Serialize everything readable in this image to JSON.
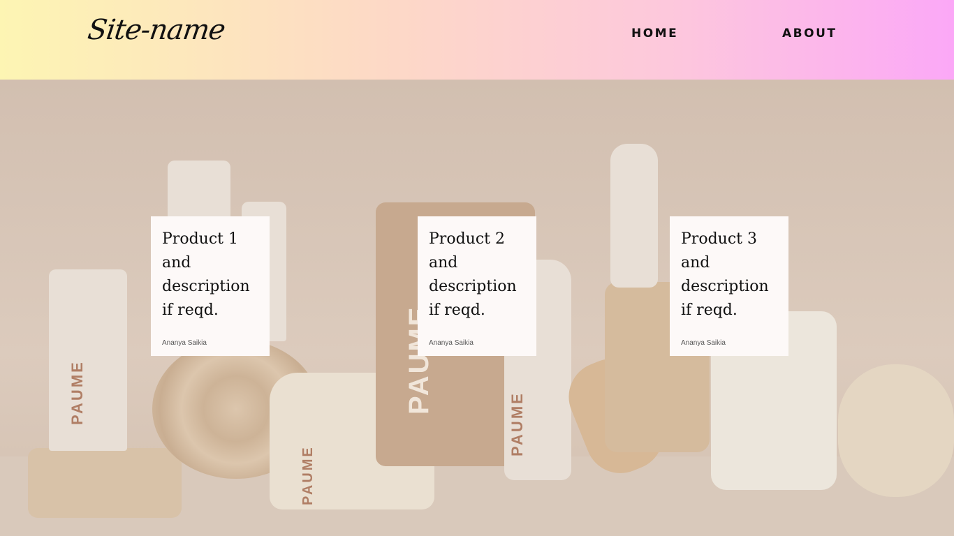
{
  "header": {
    "logo_text": "Site-name",
    "nav": {
      "home_label": "HOME",
      "about_label": "ABOUT"
    }
  },
  "hero": {
    "brand_mark": "PAUME"
  },
  "products": [
    {
      "title": "Product 1 and description if reqd.",
      "author": "Ananya Saikia"
    },
    {
      "title": "Product 2 and description if reqd.",
      "author": "Ananya Saikia"
    },
    {
      "title": "Product 3 and description if reqd.",
      "author": "Ananya Saikia"
    }
  ]
}
